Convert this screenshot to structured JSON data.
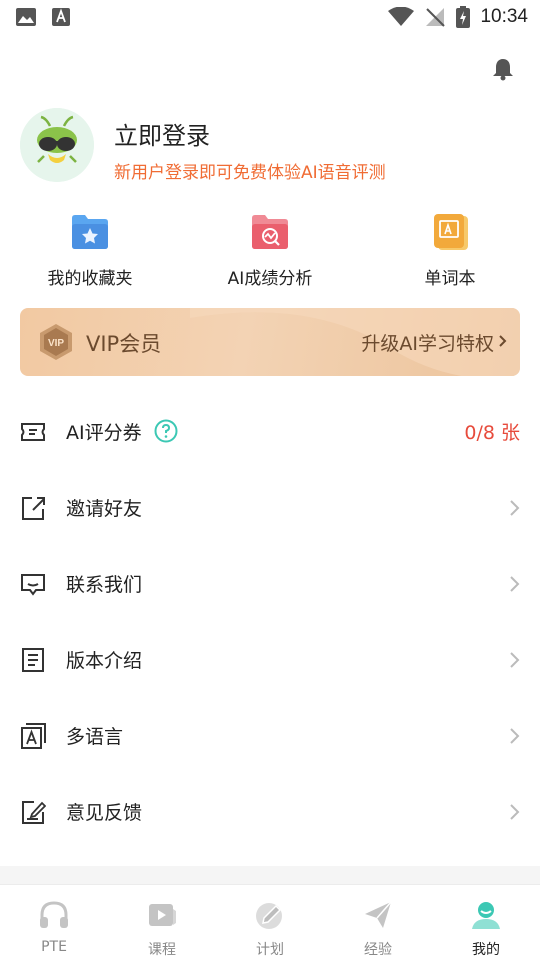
{
  "status_bar": {
    "time": "10:34"
  },
  "profile": {
    "title": "立即登录",
    "subtitle": "新用户登录即可免费体验AI语音评测"
  },
  "quick_actions": [
    {
      "label": "我的收藏夹",
      "icon": "folder-star-icon"
    },
    {
      "label": "AI成绩分析",
      "icon": "analysis-folder-icon"
    },
    {
      "label": "单词本",
      "icon": "vocabulary-book-icon"
    }
  ],
  "vip": {
    "title": "VIP会员",
    "cta": "升级AI学习特权",
    "badge": "VIP"
  },
  "menu": [
    {
      "label": "AI评分券",
      "value": "0/8 张",
      "icon": "ticket-icon"
    },
    {
      "label": "邀请好友",
      "icon": "share-icon"
    },
    {
      "label": "联系我们",
      "icon": "message-icon"
    },
    {
      "label": "版本介绍",
      "icon": "document-icon"
    },
    {
      "label": "多语言",
      "icon": "language-icon"
    },
    {
      "label": "意见反馈",
      "icon": "feedback-icon"
    }
  ],
  "tabs": [
    {
      "label": "PTE",
      "icon": "headphones-icon"
    },
    {
      "label": "课程",
      "icon": "video-play-icon"
    },
    {
      "label": "计划",
      "icon": "pencil-icon"
    },
    {
      "label": "经验",
      "icon": "paper-plane-icon"
    },
    {
      "label": "我的",
      "icon": "profile-icon",
      "active": true
    }
  ],
  "colors": {
    "accent": "#3cc8b4",
    "warning_text": "#f06c34",
    "value_red": "#e74b3c",
    "vip_text": "#6b4a2e",
    "vip_bg": "#f2c9a2"
  }
}
